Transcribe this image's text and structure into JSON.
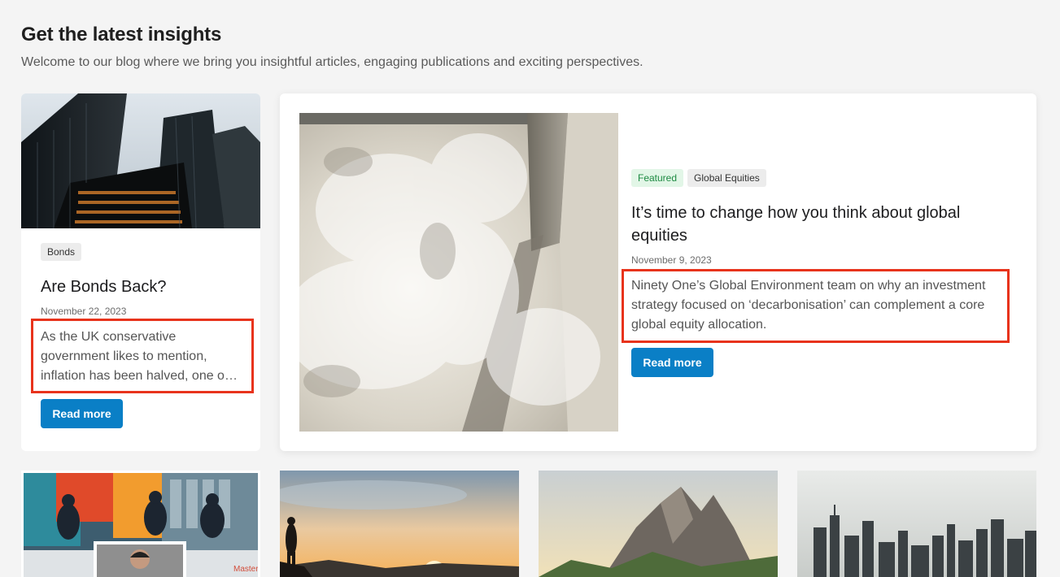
{
  "header": {
    "title": "Get the latest insights",
    "subtitle": "Welcome to our blog where we bring you insightful articles, engaging publications and exciting perspectives."
  },
  "cards": [
    {
      "tags": [
        "Bonds"
      ],
      "title": "Are Bonds Back?",
      "date": "November 22, 2023",
      "excerpt_lines": [
        "As the UK conservative",
        "government likes to mention,",
        "inflation has been halved, one o…"
      ],
      "button": "Read more",
      "image": "skyscrapers-photo"
    },
    {
      "tags": [
        "Featured",
        "Global Equities"
      ],
      "title_lines": [
        "It’s time to change how you think about global",
        "equities"
      ],
      "date": "November 9, 2023",
      "excerpt_lines": [
        "Ninety One’s Global Environment team on why an investment",
        "strategy focused on ‘decarbonisation’ can complement a core",
        "global equity allocation."
      ],
      "button": "Read more",
      "image": "dam-waterfall-photo"
    }
  ],
  "bottom_row": [
    {
      "image": "tv-studio-photo",
      "overlay_text": "Masterclass"
    },
    {
      "image": "sunset-hiker-photo"
    },
    {
      "image": "mountain-peaks-photo"
    },
    {
      "image": "city-skyline-photo"
    }
  ],
  "colors": {
    "accent": "#0a7fc6",
    "highlight": "#e8331c",
    "featured_tag_bg": "#e2f6e7",
    "featured_tag_text": "#1d8a42"
  }
}
